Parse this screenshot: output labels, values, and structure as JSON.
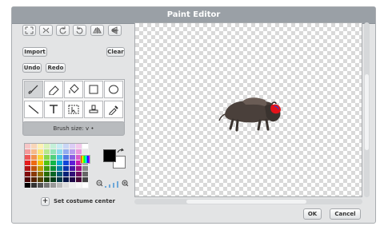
{
  "title": "Paint Editor",
  "toolbar_icons": [
    "zoom-fit-icon",
    "zoom-in-grid-icon",
    "rotate-left-icon",
    "rotate-right-icon",
    "flip-horizontal-icon",
    "flip-vertical-icon"
  ],
  "buttons": {
    "import": "Import",
    "clear": "Clear",
    "undo": "Undo",
    "redo": "Redo",
    "ok": "OK",
    "cancel": "Cancel"
  },
  "tools": [
    "brush",
    "eraser",
    "fill",
    "rectangle",
    "ellipse",
    "line",
    "text",
    "select",
    "stamp",
    "eyedropper"
  ],
  "brush_size": {
    "label": "Brush size:",
    "arrow": "v",
    "dot": "•"
  },
  "set_costume_center": {
    "plus": "+",
    "label": "Set costume center"
  },
  "colors": {
    "accent_title": "#9aa0a6",
    "primary": "#000000",
    "secondary": "#ffffff",
    "swatches": [
      [
        "#f7c6c6",
        "#f9d6b8",
        "#fdf2b3",
        "#d9f3b8",
        "#c4f0d9",
        "#c7ecf4",
        "#c9d6f6",
        "#dcccf6",
        "#f3c8ec",
        "#ffffff"
      ],
      [
        "#f49a9a",
        "#f6b98a",
        "#fbe57a",
        "#b6e88a",
        "#90e3b6",
        "#8fd9ec",
        "#93acef",
        "#b79cee",
        "#e995dc",
        "#e6e6e6"
      ],
      [
        "#ee5656",
        "#f2934f",
        "#f8d535",
        "#86d94b",
        "#4fd07d",
        "#47c1e1",
        "#5177e6",
        "#8c5de3",
        "#dc5acb",
        "#cccccc"
      ],
      [
        "#e61d1d",
        "#ee6b12",
        "#f3c300",
        "#52c411",
        "#12b649",
        "#0ca7d3",
        "#1246d9",
        "#5e1fd6",
        "#c81aa9",
        "#aaaaaa"
      ],
      [
        "#b31414",
        "#bf540c",
        "#c49a00",
        "#3e9a0a",
        "#0a8f38",
        "#087fa3",
        "#0c33aa",
        "#4716a6",
        "#9c1384",
        "#888888"
      ],
      [
        "#800c0c",
        "#8a3a07",
        "#8c6e00",
        "#2a6d05",
        "#066526",
        "#055a74",
        "#082378",
        "#320f77",
        "#6f0d5e",
        "#666666"
      ],
      [
        "#4d0606",
        "#552303",
        "#564300",
        "#194103",
        "#033c16",
        "#033746",
        "#051548",
        "#1e0847",
        "#430837",
        "#444444"
      ],
      [
        "#000000",
        "#333333",
        "#555555",
        "#777777",
        "#999999",
        "#bbbbbb",
        "#dddddd",
        "#eeeeee",
        "#f6f6f6",
        "#ffffff"
      ]
    ]
  }
}
